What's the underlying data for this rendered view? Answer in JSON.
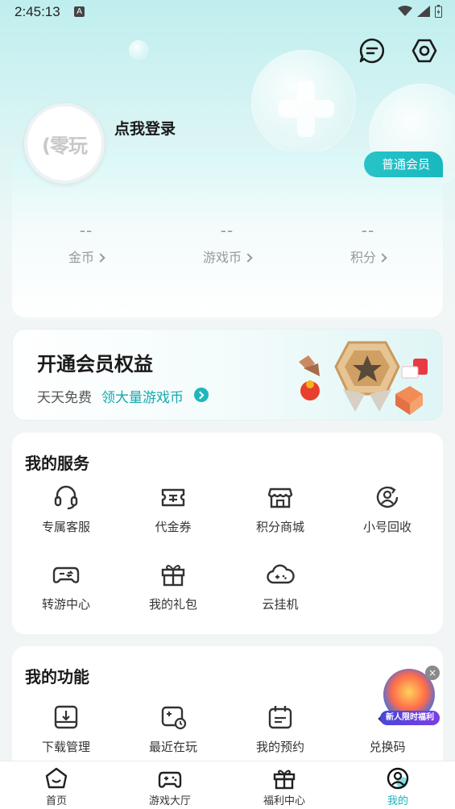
{
  "status_bar": {
    "time": "2:45:13",
    "notify_icon": "A"
  },
  "header": {
    "message_icon": "message-icon",
    "settings_icon": "settings-icon"
  },
  "profile": {
    "avatar_text": "(零玩",
    "login_label": "点我登录"
  },
  "member_card": {
    "badge": "普通会员",
    "stats": [
      {
        "value": "--",
        "label": "金币"
      },
      {
        "value": "--",
        "label": "游戏币"
      },
      {
        "value": "--",
        "label": "积分"
      }
    ]
  },
  "vip_banner": {
    "title": "开通会员权益",
    "subtitle": "天天免费",
    "highlight": "领大量游戏币"
  },
  "services": {
    "title": "我的服务",
    "items": [
      {
        "label": "专属客服",
        "icon": "headset-icon"
      },
      {
        "label": "代金券",
        "icon": "voucher-icon"
      },
      {
        "label": "积分商城",
        "icon": "store-icon"
      },
      {
        "label": "小号回收",
        "icon": "recycle-user-icon"
      },
      {
        "label": "转游中心",
        "icon": "gamepad-icon"
      },
      {
        "label": "我的礼包",
        "icon": "gift-icon"
      },
      {
        "label": "云挂机",
        "icon": "cloud-game-icon"
      }
    ]
  },
  "functions": {
    "title": "我的功能",
    "items": [
      {
        "label": "下载管理",
        "icon": "download-icon"
      },
      {
        "label": "最近在玩",
        "icon": "recent-play-icon"
      },
      {
        "label": "我的预约",
        "icon": "calendar-icon"
      },
      {
        "label": "兑换码",
        "icon": "code-icon"
      }
    ]
  },
  "promo": {
    "tag": "新人限时福利",
    "close": "×"
  },
  "bottom_nav": [
    {
      "label": "首页",
      "icon": "home-icon"
    },
    {
      "label": "游戏大厅",
      "icon": "game-hall-icon"
    },
    {
      "label": "福利中心",
      "icon": "gift-icon"
    },
    {
      "label": "我的",
      "icon": "profile-icon"
    }
  ],
  "colors": {
    "accent": "#16b4ba",
    "badge": "#1fb9bf",
    "background": "#f2f5f6"
  }
}
